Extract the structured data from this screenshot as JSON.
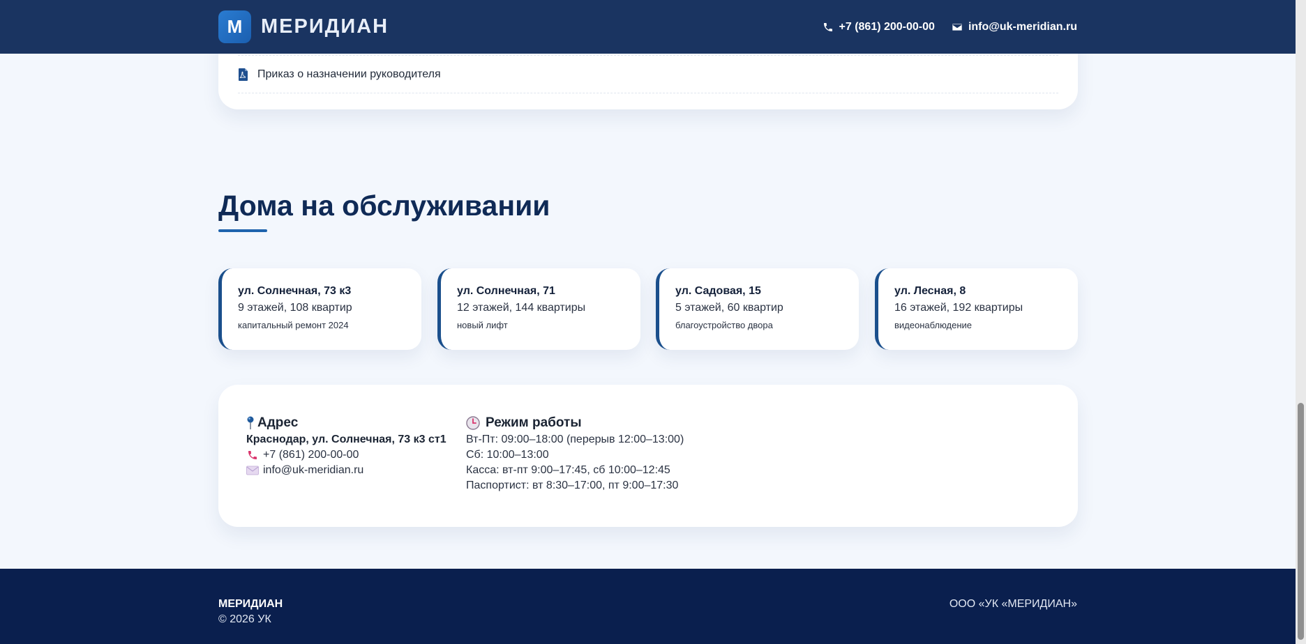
{
  "header": {
    "logo_letter": "M",
    "brand": "МЕРИДИАН",
    "phone": "+7 (861) 200-00-00",
    "email": "info@uk-meridian.ru"
  },
  "documents": {
    "items": [
      {
        "label": "Приказ о назначении руководителя",
        "icon": "pdf-icon"
      }
    ]
  },
  "houses": {
    "title": "Дома на обслуживании",
    "items": [
      {
        "address": "ул. Солнечная, 73 к3",
        "meta": "9 этажей, 108 квартир",
        "note": "капитальный ремонт 2024"
      },
      {
        "address": "ул. Солнечная, 71",
        "meta": "12 этажей, 144 квартиры",
        "note": "новый лифт"
      },
      {
        "address": "ул. Садовая, 15",
        "meta": "5 этажей, 60 квартир",
        "note": "благоустройство двора"
      },
      {
        "address": "ул. Лесная, 8",
        "meta": "16 этажей, 192 квартиры",
        "note": "видеонаблюдение"
      }
    ]
  },
  "contacts": {
    "address_heading": "Адрес",
    "address": "Краснодар, ул. Солнечная, 73 к3 ст1",
    "phone": "+7 (861) 200-00-00",
    "email": "info@uk-meridian.ru",
    "hours_heading": "Режим работы",
    "hours": [
      "Вт-Пт: 09:00–18:00 (перерыв 12:00–13:00)",
      "Сб: 10:00–13:00",
      "Касса: вт-пт 9:00–17:45, сб 10:00–12:45",
      "Паспортист: вт 8:30–17:00, пт 9:00–17:30"
    ]
  },
  "footer": {
    "brand": "МЕРИДИАН",
    "copyright": "© 2026 УК",
    "company": "ООО «УК «МЕРИДИАН»"
  },
  "colors": {
    "header_bg": "#1a3461",
    "accent": "#1e63ad",
    "footer_bg": "#0a1f4e",
    "page_bg": "#f3f7fd"
  }
}
